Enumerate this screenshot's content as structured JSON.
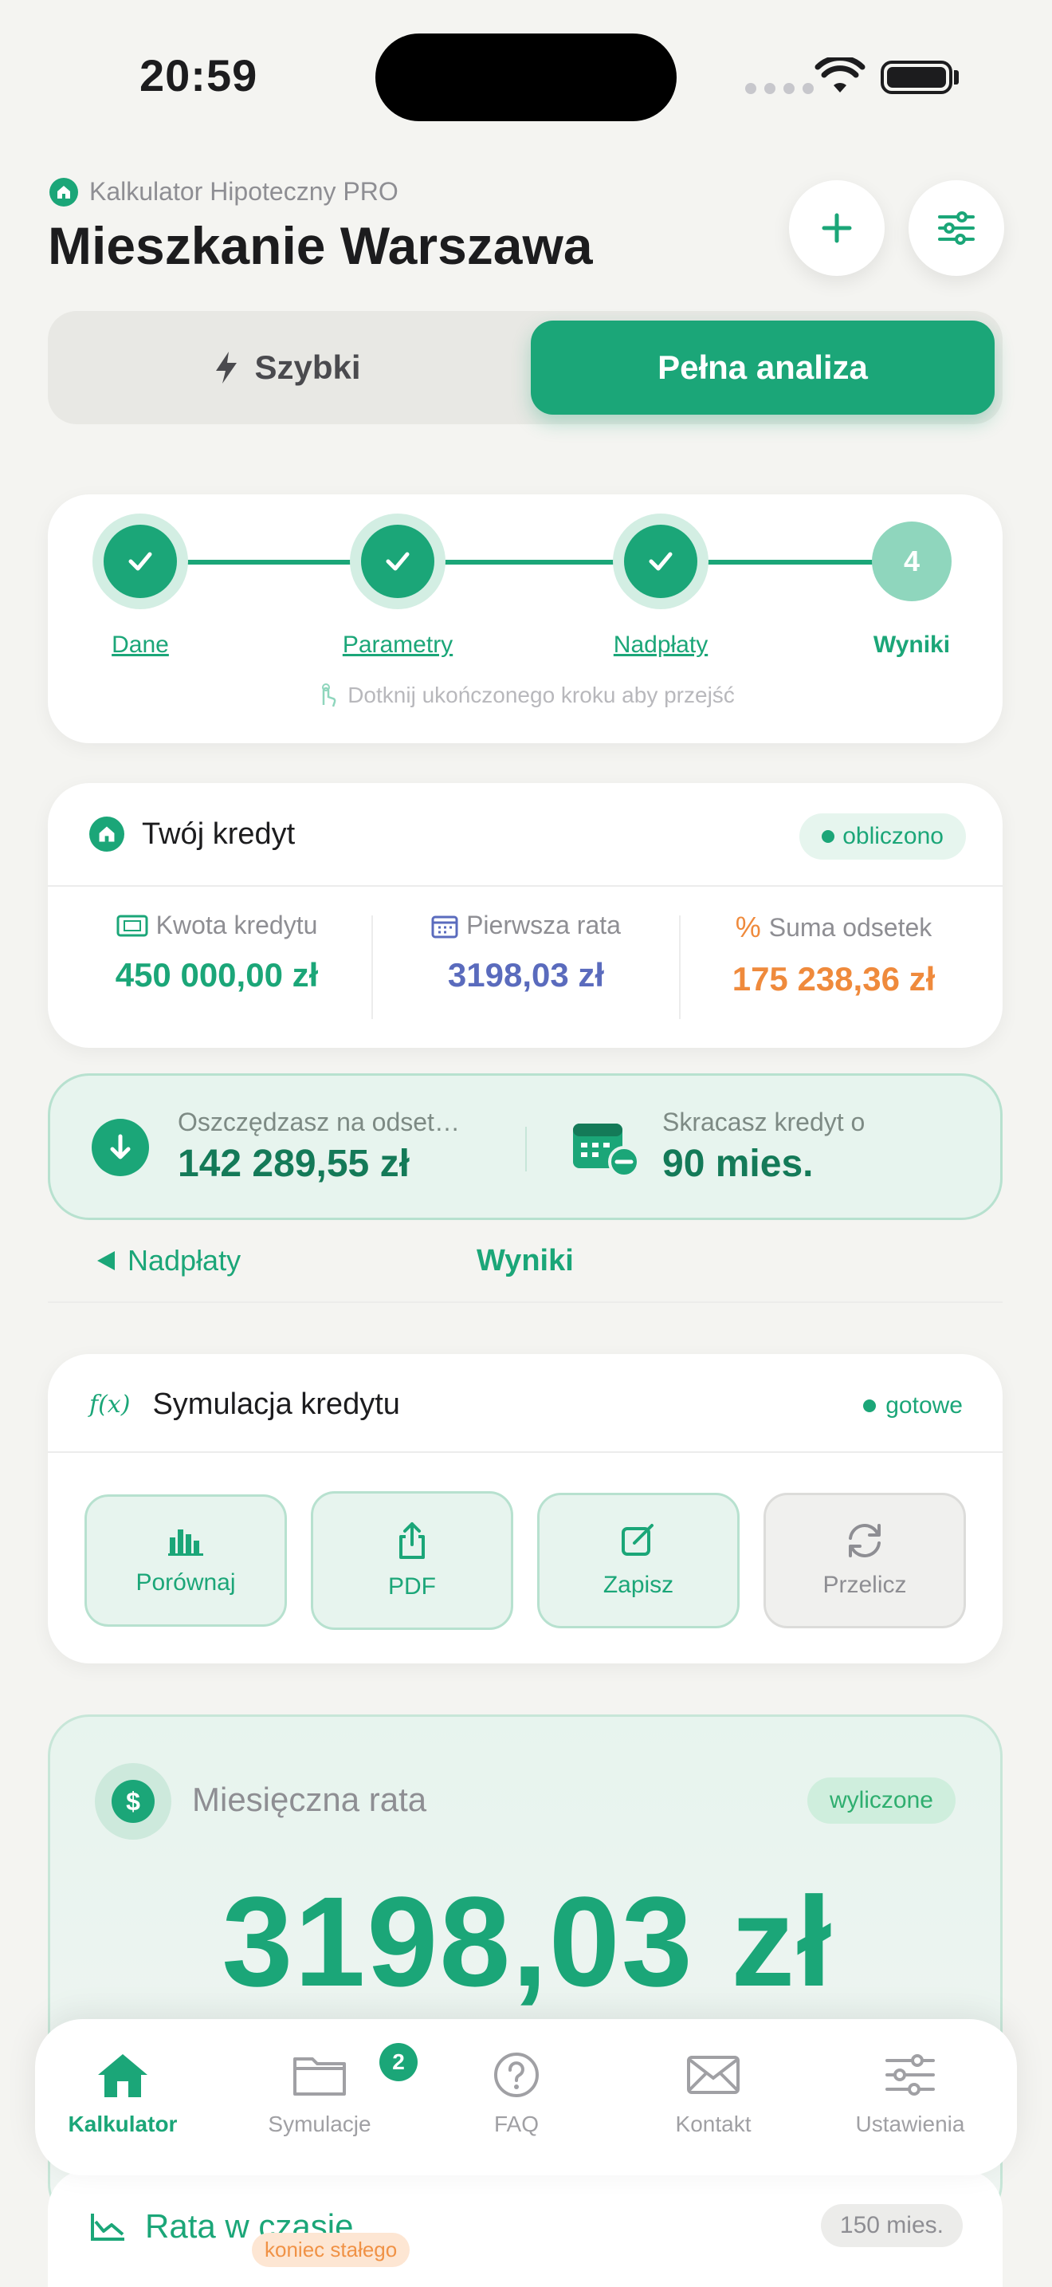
{
  "status_bar": {
    "time": "20:59"
  },
  "header": {
    "app_name": "Kalkulator Hipoteczny PRO",
    "title": "Mieszkanie Warszawa"
  },
  "mode_toggle": {
    "quick": "Szybki",
    "full": "Pełna analiza"
  },
  "steps": {
    "items": [
      {
        "label": "Dane",
        "state": "done"
      },
      {
        "label": "Parametry",
        "state": "done"
      },
      {
        "label": "Nadpłaty",
        "state": "done"
      },
      {
        "label": "Wyniki",
        "number": "4",
        "state": "current"
      }
    ],
    "hint": "Dotknij ukończonego kroku aby przejść"
  },
  "credit": {
    "title": "Twój kredyt",
    "status": "obliczono",
    "stats": [
      {
        "label": "Kwota kredytu",
        "value": "450 000,00 zł",
        "color": "#1ba678"
      },
      {
        "label": "Pierwsza rata",
        "value": "3198,03 zł",
        "color": "#5a6bbd"
      },
      {
        "label": "Suma odsetek",
        "value": "175 238,36 zł",
        "color": "#ef8a3c"
      }
    ]
  },
  "savings": {
    "interest_label": "Oszczędzasz na odset…",
    "interest_value": "142 289,55 zł",
    "shorten_label": "Skracasz kredyt o",
    "shorten_value": "90 mies."
  },
  "nav": {
    "back": "Nadpłaty",
    "current": "Wyniki"
  },
  "simulation": {
    "title": "Symulacja kredytu",
    "fx_icon": "f(x)",
    "status": "gotowe",
    "actions": [
      {
        "label": "Porównaj",
        "icon": "bar-chart-icon"
      },
      {
        "label": "PDF",
        "icon": "share-icon"
      },
      {
        "label": "Zapisz",
        "icon": "edit-icon"
      },
      {
        "label": "Przelicz",
        "icon": "refresh-icon"
      }
    ]
  },
  "monthly": {
    "label": "Miesięczna rata",
    "status": "wyliczone",
    "currency_icon": "$",
    "value": "3198,03 zł"
  },
  "rate_over_time": {
    "title": "Rata w czasie",
    "badge": "150 mies.",
    "marker": "koniec stałego"
  },
  "tabbar": {
    "items": [
      {
        "label": "Kalkulator"
      },
      {
        "label": "Symulacje",
        "badge": "2"
      },
      {
        "label": "FAQ"
      },
      {
        "label": "Kontakt"
      },
      {
        "label": "Ustawienia"
      }
    ]
  },
  "colors": {
    "accent": "#1ba678",
    "indigo": "#5a6bbd",
    "orange": "#ef8a3c"
  }
}
